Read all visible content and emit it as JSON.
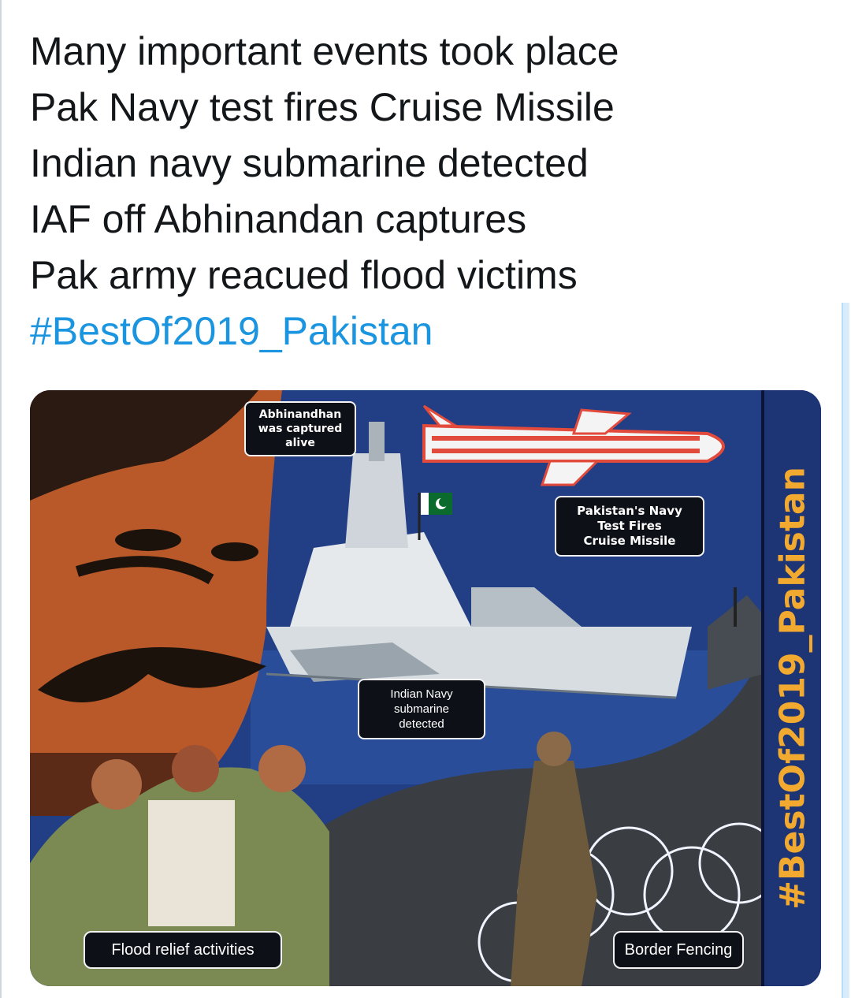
{
  "tweet": {
    "lines": [
      "Many important events took place",
      "Pak Navy test fires Cruise Missile",
      "Indian navy submarine detected",
      "IAF off Abhinandan captures",
      "Pak army reacued flood victims"
    ],
    "hashtag": "#BestOf2019_Pakistan"
  },
  "media": {
    "side_banner_text": "#BestOf2019_Pakistan",
    "captions": {
      "captured": "Abhinandhan\nwas captured\nalive",
      "missile": "Pakistan's Navy\nTest Fires\nCruise Missile",
      "submarine": "Indian Navy\nsubmarine\ndetected",
      "flood": "Flood relief activities",
      "border": "Border Fencing"
    }
  },
  "colors": {
    "text": "#14171a",
    "link": "#1b95e0",
    "poster_bg": "#223f86",
    "banner_text": "#f2a92f"
  },
  "icons": [
    "pakistan-flag-icon",
    "cruise-missile-icon"
  ]
}
